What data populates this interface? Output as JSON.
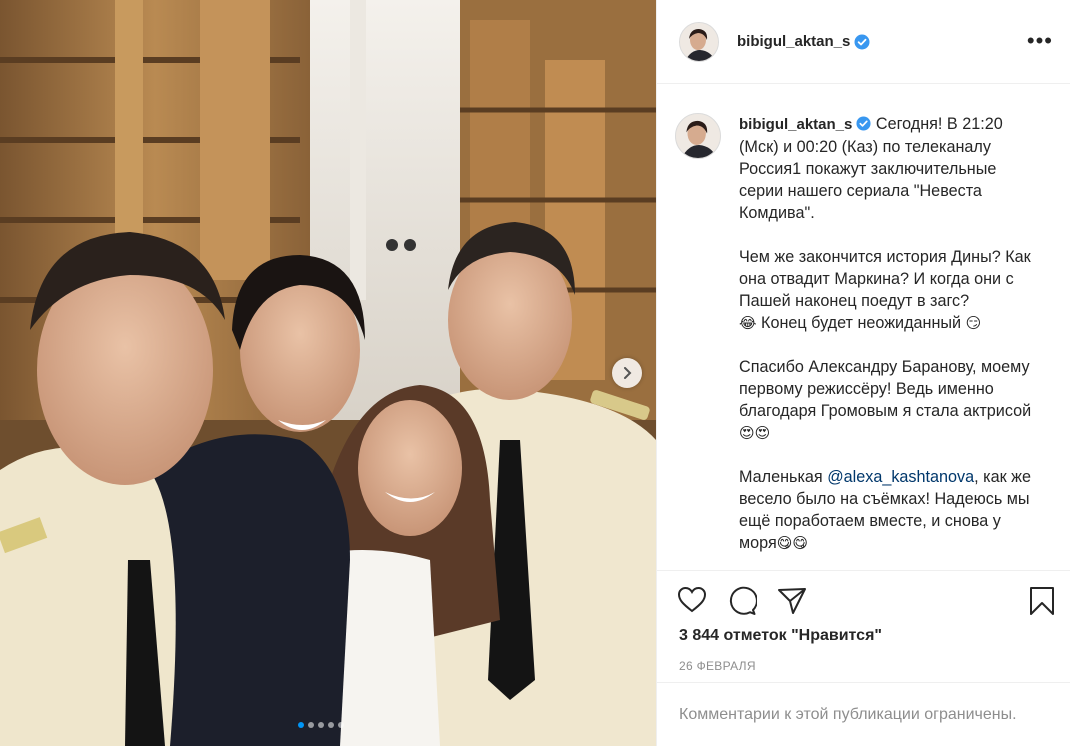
{
  "post": {
    "username": "bibigul_aktan_s",
    "verified": true,
    "more_label": "•••",
    "caption": {
      "p1": "Сегодня! В 21:20 (Мск) и 00:20 (Каз) по телеканалу Россия1 покажут заключительные серии нашего сериала \"Невеста Комдива\".",
      "p2_text": "Чем же закончится история Дины? Как она отвадит Маркина? И когда они с Пашей наконец поедут в загс?",
      "p2_emoji_a": "😂",
      "p2_tail": " Конец будет неожиданный ",
      "p2_emoji_b": "😏",
      "p3_text": "Спасибо Александру Баранову, моему первому режиссёру! Ведь именно благодаря Громовым я стала актрисой ",
      "p3_emoji": "😍😍",
      "p4_before": "Маленькая ",
      "p4_mention": "@alexa_kashtanova",
      "p4_after": ", как же весело было на съёмках! Надеюсь мы ещё поработаем вместе, и снова у моря",
      "p4_emoji": "😋😋"
    },
    "likes_text": "3 844 отметок \"Нравится\"",
    "date": "26 ФЕВРАЛЯ",
    "comments_restricted": "Комментарии к этой публикации ограничены.",
    "carousel": {
      "count": 5,
      "active_index": 0
    }
  },
  "icons": {
    "like": "heart-icon",
    "comment": "comment-icon",
    "share": "paper-plane-icon",
    "save": "bookmark-icon",
    "next": "chevron-right-icon",
    "verified": "verified-badge-icon"
  },
  "colors": {
    "verified_blue": "#3897f0",
    "mention": "#00376b",
    "muted": "#8e8e8e",
    "carousel_active": "#0095f6"
  }
}
